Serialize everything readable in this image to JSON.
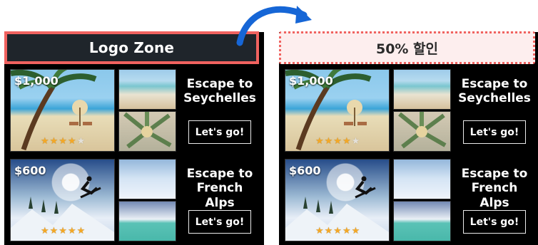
{
  "colors": {
    "accent_red": "#f0625f",
    "arrow_blue": "#1666d6",
    "left_header_bg": "#1f252b",
    "right_header_bg": "#fdeeee",
    "star_gold": "#f4a826"
  },
  "headers": {
    "left": "Logo Zone",
    "right": "50% 할인"
  },
  "panels": {
    "left": {
      "ads": [
        {
          "price": "$1,000",
          "title_line1": "Escape to",
          "title_line2": "Seychelles",
          "button": "Let's go!",
          "stars_filled": 4,
          "stars_total": 5
        },
        {
          "price": "$600",
          "title_line1": "Escape to",
          "title_line2": "French Alps",
          "button": "Let's go!",
          "stars_filled": 5,
          "stars_total": 5
        }
      ]
    },
    "right": {
      "ads": [
        {
          "price": "$1,000",
          "title_line1": "Escape to",
          "title_line2": "Seychelles",
          "button": "Let's go!",
          "stars_filled": 4,
          "stars_total": 5
        },
        {
          "price": "$600",
          "title_line1": "Escape to",
          "title_line2": "French Alps",
          "button": "Let's go!",
          "stars_filled": 5,
          "stars_total": 5
        }
      ]
    }
  },
  "icons": {
    "arrow": "curved-arrow-icon",
    "star": "star-icon",
    "palm": "palm-icon",
    "skier": "skier-icon"
  }
}
